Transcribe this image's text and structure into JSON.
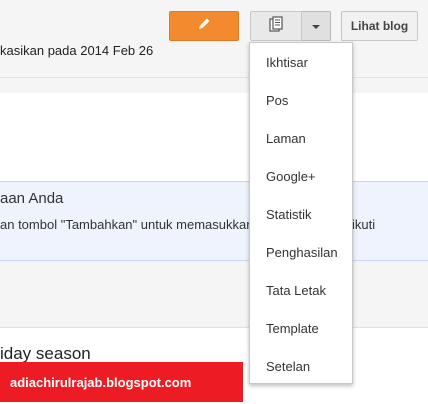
{
  "toolbar": {
    "edit_icon": "pencil-icon",
    "pages_icon": "document-copy-icon",
    "caret_icon": "caret-down-icon",
    "view_blog_label": "Lihat blog",
    "brand_orange": "#f38a2e"
  },
  "status": {
    "published_text": "kasikan pada 2014 Feb 26"
  },
  "panel": {
    "title": "aan Anda",
    "text_left": "an tombol \"Tambahkan\" untuk memasukkan",
    "text_right": "ikuti",
    "background": "#eef3fe"
  },
  "post": {
    "title_fragment": "iday season"
  },
  "watermark": {
    "text": "adiachirulrajab.blogspot.com",
    "color": "#ed1c24"
  },
  "menu": {
    "items": [
      {
        "label": "Ikhtisar"
      },
      {
        "label": "Pos"
      },
      {
        "label": "Laman"
      },
      {
        "label": "Google+"
      },
      {
        "label": "Statistik"
      },
      {
        "label": "Penghasilan"
      },
      {
        "label": "Tata Letak"
      },
      {
        "label": "Template"
      },
      {
        "label": "Setelan"
      }
    ]
  }
}
